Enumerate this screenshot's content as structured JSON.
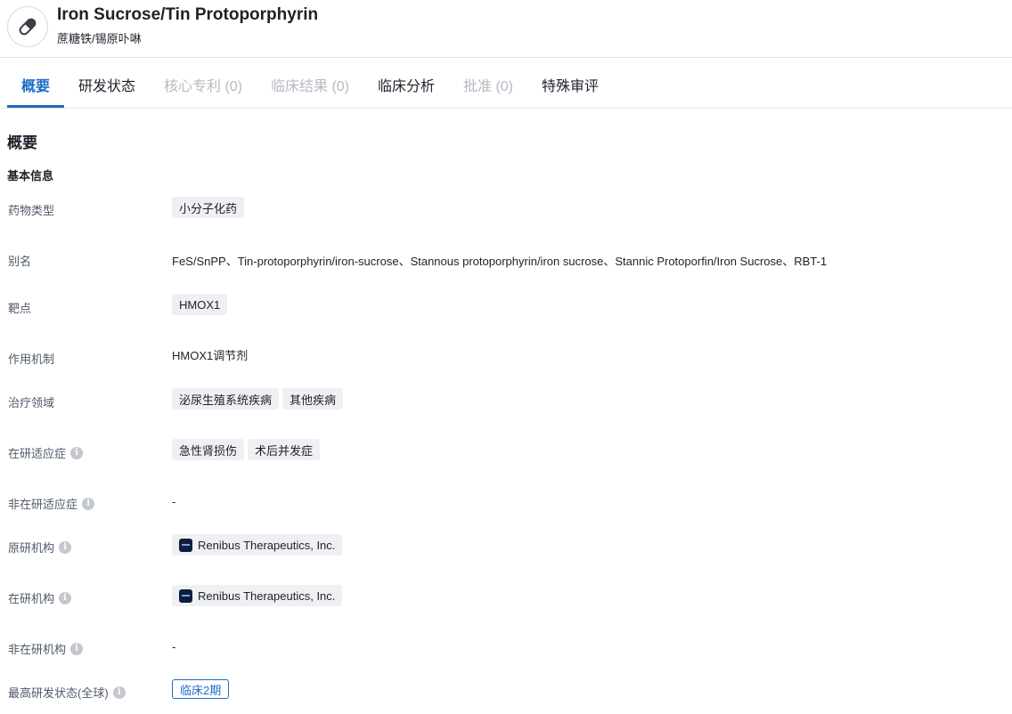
{
  "header": {
    "icon": "pill-icon",
    "title": "Iron Sucrose/Tin Protoporphyrin",
    "subtitle": "蔗糖铁/锡原卟啉"
  },
  "tabs": [
    {
      "label": "概要",
      "state": "active"
    },
    {
      "label": "研发状态",
      "state": "normal"
    },
    {
      "label": "核心专利 (0)",
      "state": "disabled"
    },
    {
      "label": "临床结果 (0)",
      "state": "disabled"
    },
    {
      "label": "临床分析",
      "state": "normal"
    },
    {
      "label": "批准 (0)",
      "state": "disabled"
    },
    {
      "label": "特殊审评",
      "state": "normal"
    }
  ],
  "overview": {
    "section_title": "概要",
    "basic_info_title": "基本信息"
  },
  "fields": {
    "drug_type": {
      "label": "药物类型",
      "chips": [
        "小分子化药"
      ]
    },
    "aliases": {
      "label": "别名",
      "value": "FeS/SnPP、Tin-protoporphyrin/iron-sucrose、Stannous protoporphyrin/iron sucrose、Stannic Protoporfin/Iron Sucrose、RBT-1"
    },
    "target": {
      "label": "靶点",
      "chips": [
        "HMOX1"
      ]
    },
    "mechanism": {
      "label": "作用机制",
      "value": "HMOX1调节剂"
    },
    "therapeutic_area": {
      "label": "治疗领域",
      "chips": [
        "泌尿生殖系统疾病",
        "其他疾病"
      ]
    },
    "active_indication": {
      "label": "在研适应症",
      "chips": [
        "急性肾损伤",
        "术后并发症"
      ]
    },
    "inactive_indication": {
      "label": "非在研适应症",
      "value": "-"
    },
    "originator": {
      "label": "原研机构",
      "org": "Renibus Therapeutics, Inc."
    },
    "active_org": {
      "label": "在研机构",
      "org": "Renibus Therapeutics, Inc."
    },
    "inactive_org": {
      "label": "非在研机构",
      "value": "-"
    },
    "highest_phase": {
      "label": "最高研发状态(全球)",
      "value": "临床2期"
    }
  },
  "colors": {
    "accent": "#1c6cc5",
    "chip_bg": "#eef0f3",
    "disabled": "#b5b9c2"
  }
}
